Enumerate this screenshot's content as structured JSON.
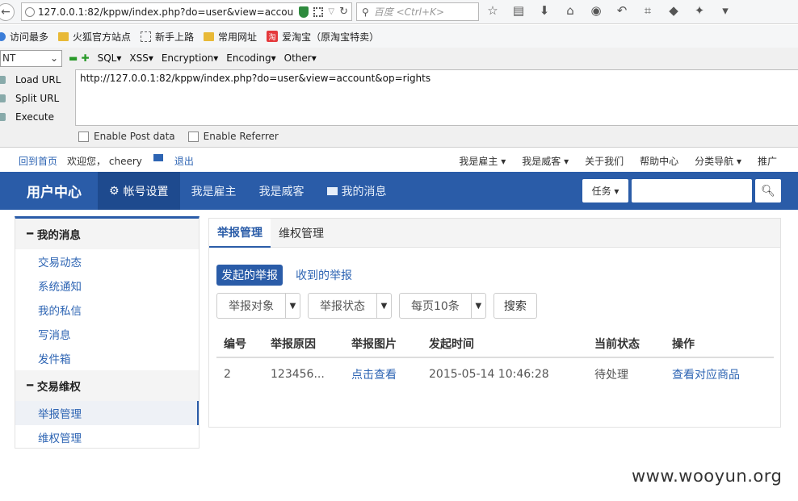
{
  "browser": {
    "url": "127.0.0.1:82/kppw/index.php?do=user&view=accou",
    "search_placeholder": "百度 <Ctrl+K>"
  },
  "bookmarks": [
    "访问最多",
    "火狐官方站点",
    "新手上路",
    "常用网址",
    "爱淘宝（原淘宝特卖）"
  ],
  "taobao_glyph": "淘",
  "hackbar": {
    "select_value": "NT",
    "menus": [
      "SQL▾",
      "XSS▾",
      "Encryption▾",
      "Encoding▾",
      "Other▾"
    ],
    "load_url": "Load URL",
    "split_url": "Split URL",
    "execute": "Execute",
    "url_value": "http://127.0.0.1:82/kppw/index.php?do=user&view=account&op=rights",
    "enable_post": "Enable Post data",
    "enable_referrer": "Enable Referrer"
  },
  "site_top": {
    "home": "回到首页",
    "welcome": "欢迎您，",
    "username": "cheery",
    "logout": "退出",
    "right_links": [
      "我是雇主 ▾",
      "我是威客 ▾",
      "关于我们",
      "帮助中心",
      "分类导航 ▾",
      "推广"
    ]
  },
  "nav": {
    "brand": "用户中心",
    "items": [
      "帐号设置",
      "我是雇主",
      "我是威客",
      "我的消息"
    ],
    "task_btn": "任务 ▾"
  },
  "sidebar": {
    "group1": "我的消息",
    "group1_items": [
      "交易动态",
      "系统通知",
      "我的私信",
      "写消息",
      "发件箱"
    ],
    "group2": "交易维权",
    "group2_items": [
      "举报管理",
      "维权管理"
    ]
  },
  "content": {
    "tabs": [
      "举报管理",
      "维权管理"
    ],
    "subtabs": [
      "发起的举报",
      "收到的举报"
    ],
    "filters": [
      "举报对象",
      "举报状态",
      "每页10条"
    ],
    "search_btn": "搜索",
    "columns": [
      "编号",
      "举报原因",
      "举报图片",
      "发起时间",
      "当前状态",
      "操作"
    ],
    "rows": [
      [
        "2",
        "123456...",
        "点击查看",
        "2015-05-14 10:46:28",
        "待处理",
        "查看对应商品"
      ]
    ]
  },
  "watermark": "www.wooyun.org",
  "colors": {
    "nav_bg": "#2a5ca8",
    "link": "#2d64b3"
  }
}
